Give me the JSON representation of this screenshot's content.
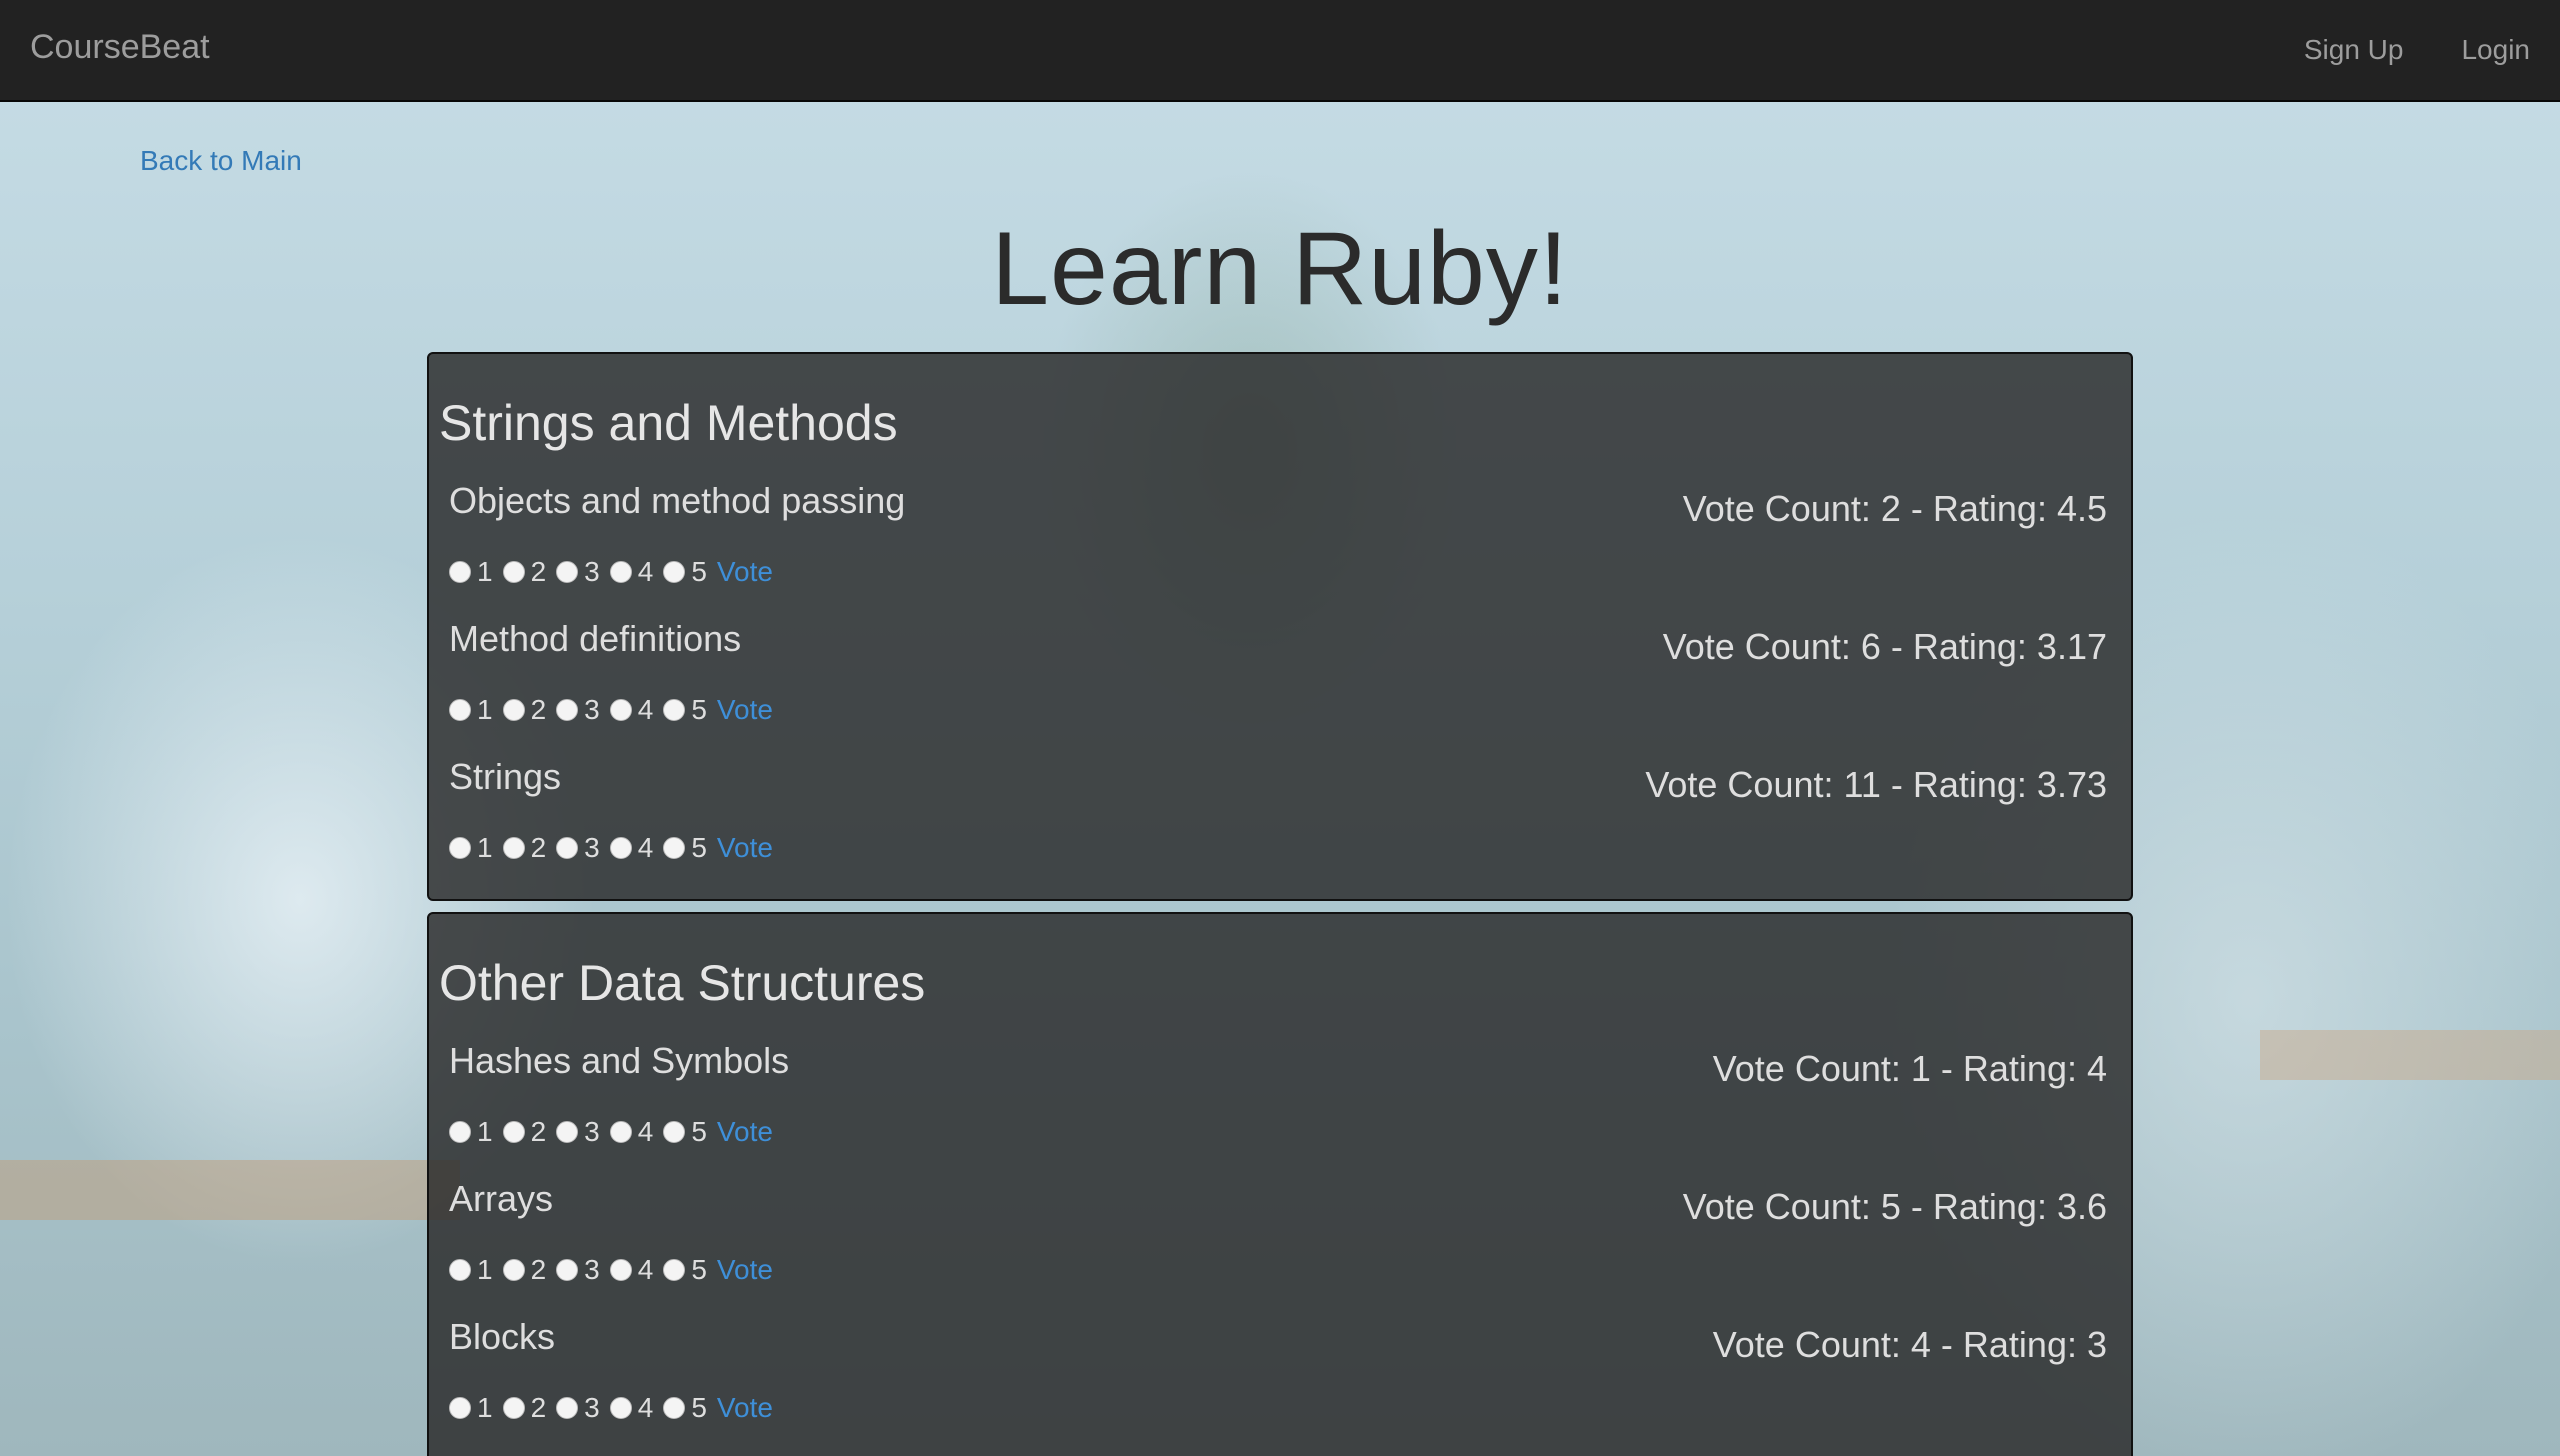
{
  "navbar": {
    "brand": "CourseBeat",
    "signup": "Sign Up",
    "login": "Login"
  },
  "back_link": "Back to Main",
  "page_title": "Learn Ruby!",
  "vote_label": "Vote",
  "rating_options": [
    "1",
    "2",
    "3",
    "4",
    "5"
  ],
  "sections": [
    {
      "title": "Strings and Methods",
      "lessons": [
        {
          "name": "Objects and method passing",
          "stats": "Vote Count: 2 - Rating: 4.5"
        },
        {
          "name": "Method definitions",
          "stats": "Vote Count: 6 - Rating: 3.17"
        },
        {
          "name": "Strings",
          "stats": "Vote Count: 11 - Rating: 3.73"
        }
      ]
    },
    {
      "title": "Other Data Structures",
      "lessons": [
        {
          "name": "Hashes and Symbols",
          "stats": "Vote Count: 1 - Rating: 4"
        },
        {
          "name": "Arrays",
          "stats": "Vote Count: 5 - Rating: 3.6"
        },
        {
          "name": "Blocks",
          "stats": "Vote Count: 4 - Rating: 3"
        }
      ]
    }
  ],
  "colors": {
    "navbar_bg": "#222222",
    "link_blue": "#337ab7",
    "panel_bg": "rgba(40,40,40,0.82)"
  }
}
